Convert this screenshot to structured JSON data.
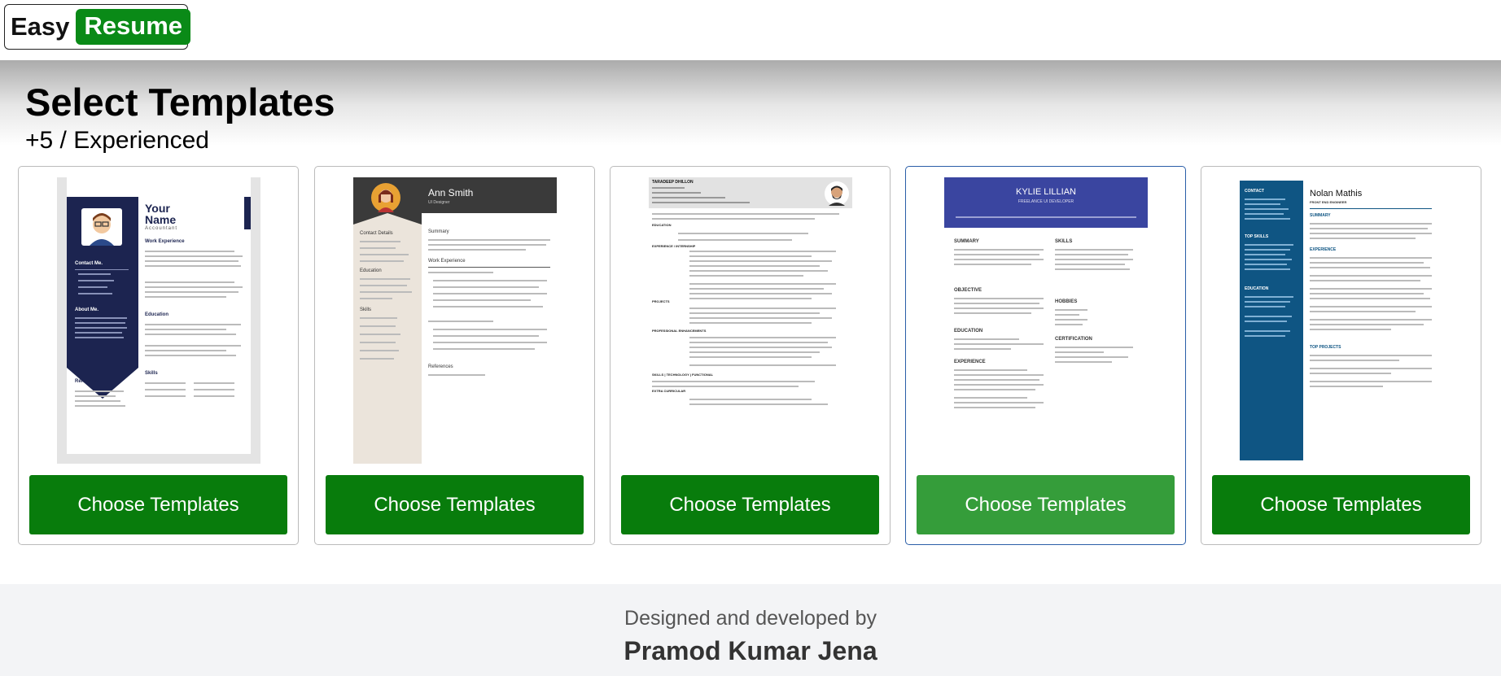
{
  "brand": {
    "part1": "Easy",
    "part2": "Resume",
    "accent": "#0a8a17"
  },
  "page": {
    "title": "Select Templates",
    "subtitle": "+5 / Experienced"
  },
  "button_color": "#087c0c",
  "templates": [
    {
      "button_label": "Choose Templates",
      "name1": "Your",
      "name2": "Name",
      "role": "Accountant",
      "s1": "Contact Me.",
      "s2": "About Me.",
      "s3": "Work Experience",
      "s4": "Education",
      "s5": "Skills",
      "s6": "Reference."
    },
    {
      "button_label": "Choose Templates",
      "name": "Ann Smith",
      "role": "UI Designer",
      "s1": "Contact Details",
      "s2": "Education",
      "s3": "Skills",
      "s4": "Summary",
      "s5": "Work Experience",
      "s6": "References"
    },
    {
      "button_label": "Choose Templates",
      "name": "TARADEEP DHILLON",
      "s1": "EDUCATION",
      "s2": "EXPERIENCE / INTERNSHIP",
      "s3": "PROJECTS",
      "s4": "PROFESSIONAL ENHANCEMENTS",
      "s5": "SKILLS | TECHNOLOGY | FUNCTIONAL",
      "s6": "EXTRA CURRICULAR"
    },
    {
      "button_label": "Choose Templates",
      "name": "KYLIE LILLIAN",
      "role": "FREELANCE UI DEVELOPER",
      "s1": "SUMMARY",
      "s2": "OBJECTIVE",
      "s3": "EDUCATION",
      "s4": "EXPERIENCE",
      "s5": "SKILLS",
      "s6": "HOBBIES",
      "s7": "CERTIFICATION"
    },
    {
      "button_label": "Choose Templates",
      "name": "Nolan Mathis",
      "role": "FRONT END ENGINEER",
      "s1": "CONTACT",
      "s2": "TOP SKILLS",
      "s3": "EDUCATION",
      "s4": "SUMMARY",
      "s5": "EXPERIENCE",
      "s6": "TOP PROJECTS"
    }
  ],
  "footer": {
    "line1": "Designed and developed by",
    "line2": "Pramod Kumar Jena"
  }
}
